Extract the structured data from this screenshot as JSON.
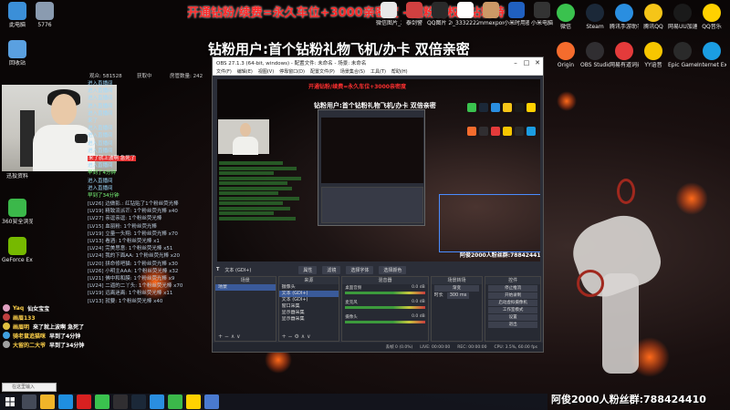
{
  "overlay": {
    "banner_top": "开通钻粉/续费=永久车位+3000亲密度 - 超粉特权+钻粉特",
    "banner_mid": "钻粉用户:首个钻粉礼物飞机/办卡 双倍亲密",
    "watermark": "阿俊2000人粉丝群:788424410",
    "stat_1": "观众: 581528",
    "stat_2": "获取中",
    "stat_3": "房管数量: 242"
  },
  "desktop_icons_left": [
    {
      "label": "此电脑",
      "icon": "computer-icon",
      "color": "#3b8fd8"
    },
    {
      "label": "5776",
      "icon": "file-icon",
      "color": "#8a9bb0"
    },
    {
      "label": "回收站",
      "icon": "recycle-bin-icon",
      "color": "#5aa0e0"
    },
    {
      "label": "迅投资料",
      "icon": "folder-icon",
      "color": "#2a5db0"
    },
    {
      "label": "360安全浏览器",
      "icon": "browser-icon",
      "color": "#3bb84a"
    },
    {
      "label": "GeForce Experience",
      "icon": "nvidia-icon",
      "color": "#76b900"
    }
  ],
  "desktop_icons_top": [
    {
      "label": "微信图片_2022062...",
      "icon": "image-icon",
      "color": "#e8e8e8"
    },
    {
      "label": "泰剑警",
      "icon": "game-icon",
      "color": "#d04040"
    },
    {
      "label": "QQ图片 20211223...",
      "icon": "image-icon",
      "color": "#2a2a2a"
    },
    {
      "label": "_3332222...",
      "icon": "file-icon",
      "color": "#ffffff"
    },
    {
      "label": "mmexport1...",
      "icon": "image-icon",
      "color": "#cc9966"
    },
    {
      "label": "小米时用器",
      "icon": "app-icon",
      "color": "#2060c0"
    },
    {
      "label": "小米电脑",
      "icon": "app-icon",
      "color": "#333333"
    }
  ],
  "desktop_icons_right": [
    {
      "label": "微信",
      "icon": "wechat-icon",
      "color": "#3ac24e"
    },
    {
      "label": "Steam",
      "icon": "steam-icon",
      "color": "#1b2838"
    },
    {
      "label": "腾讯手游助手",
      "icon": "tencent-icon",
      "color": "#2a8ee0"
    },
    {
      "label": "腾讯QQ",
      "icon": "qq-icon",
      "color": "#f5c518"
    },
    {
      "label": "网易UU加速器",
      "icon": "uu-icon",
      "color": "#1a1a1a"
    },
    {
      "label": "QQ音乐",
      "icon": "music-icon",
      "color": "#ffd100"
    },
    {
      "label": "Origin",
      "icon": "origin-icon",
      "color": "#f56c2d"
    },
    {
      "label": "OBS Studio",
      "icon": "obs-icon",
      "color": "#302e31"
    },
    {
      "label": "网易有道词典",
      "icon": "youdao-icon",
      "color": "#e43b3b"
    },
    {
      "label": "YY语音",
      "icon": "yy-icon",
      "color": "#f7c600"
    },
    {
      "label": "Epic Games Launcher",
      "icon": "epic-icon",
      "color": "#2a2a2a"
    },
    {
      "label": "Internet Explorer",
      "icon": "ie-icon",
      "color": "#1b9de2"
    }
  ],
  "chat_top": [
    {
      "text": "进入直播间",
      "style": "normal"
    },
    {
      "text": "进入直播间",
      "style": "normal"
    },
    {
      "text": "进入直播间",
      "style": "normal"
    },
    {
      "text": "进入直播间",
      "style": "normal"
    },
    {
      "text": "进入直播间",
      "style": "normal"
    },
    {
      "text": "来了",
      "style": "normal"
    },
    {
      "text": "进入直播间",
      "style": "normal"
    },
    {
      "text": "进入直播间",
      "style": "normal"
    },
    {
      "text": "进入直播间",
      "style": "normal"
    },
    {
      "text": "进入直播间",
      "style": "normal"
    },
    {
      "text": "来了就上波啊 急死了",
      "style": "highlight"
    },
    {
      "text": "进入直播间",
      "style": "normal"
    },
    {
      "text": "早到了4分钟",
      "style": "green"
    },
    {
      "text": "进入直播间",
      "style": "normal"
    },
    {
      "text": "进入直播间",
      "style": "normal"
    },
    {
      "text": "早到了34分钟",
      "style": "green"
    }
  ],
  "chat_gifts": [
    "[LV26] 边做影.: 红钻贴了1个粉丝荧光棒",
    "[LV19] 精致流派芒: 1个粉丝荧光棒 x40",
    "[LV27] 亲逗亲逗: 1个粉丝荧光棒",
    "[LV15] 血丽粉: 1个粉丝荧光棒",
    "[LV19] 立量一头翔: 1个粉丝荧光棒 x70",
    "[LV13] 看酒: 1个粉丝荧光棒 x1",
    "[LV24] 完美思意: 1个粉丝荧光棒 x51",
    "[LV24] 我的下面AA: 1个粉丝荧光棒 x20",
    "[LV20] 拼命修吧猫: 1个粉丝荧光棒 x30",
    "[LV26] 小明主AAA: 1个粉丝荧光棒 x32",
    "[LV21] 佛中和和膜: 1个粉丝荧光棒 x9",
    "[LV24] 二逼的二丫头: 1个粉丝荧光棒 x70",
    "[LV19] 远离迷离: 1个粉丝荧光棒 x11",
    "[LV13] 就要: 1个粉丝荧光棒 x40"
  ],
  "chat_bottom": [
    {
      "name": "Yaq",
      "msg": "仙女宝宝",
      "color": "#e0a0c0"
    },
    {
      "name": "画眉133",
      "msg": "",
      "color": "#c04040"
    },
    {
      "name": "画眉明",
      "msg": "来了就上波啊 急死了",
      "color": "#e0c040"
    },
    {
      "name": "骑老鼠追猫咪",
      "msg": "早到了4分钟",
      "color": "#40a0e0"
    },
    {
      "name": "大留的二大爷",
      "msg": "早到了34分钟",
      "color": "#a0a0a0"
    }
  ],
  "obs": {
    "title": "OBS 27.1.3 (64-bit, windows) - 配置文件: 未命名 - 场景: 未命名",
    "menu": [
      "文件(F)",
      "编辑(E)",
      "视图(V)",
      "停靠窗口(D)",
      "配置文件(P)",
      "场景集合(S)",
      "工具(T)",
      "帮助(H)"
    ],
    "preview_banner": "开通钻粉/续费=永久车位+3000亲密度",
    "preview_banner2": "钻粉用户:首个钻粉礼物飞机/办卡 双倍亲密",
    "preview_footer": "阿俊2000人粉丝群:788424410",
    "toolbar_label": "文本 (GDI+)",
    "toolbar_buttons": [
      "属性",
      "滤镜",
      "选择字体",
      "选择颜色"
    ],
    "docks": {
      "scenes_title": "场景",
      "scenes": [
        "场景"
      ],
      "sources_title": "来源",
      "sources": [
        "摄像头",
        "文本 (GDI+)",
        "文本 (GDI+)",
        "窗口采集",
        "显示器采集",
        "显示器采集"
      ],
      "mixer_title": "混音器",
      "mixer": [
        {
          "name": "桌面音频",
          "db": "0.0 dB"
        },
        {
          "name": "麦克风",
          "db": "0.0 dB"
        },
        {
          "name": "摄像头",
          "db": "0.0 dB"
        }
      ],
      "transitions_title": "场景转场",
      "transition_type": "渐变",
      "duration_label": "时长",
      "duration_value": "300 ms",
      "controls_title": "控件",
      "controls": [
        "停止推流",
        "开始录制",
        "启动虚拟摄像机",
        "工作室模式",
        "设置",
        "退出"
      ]
    },
    "status": [
      "丢帧 0 (0.0%)",
      "LIVE: 00:00:00",
      "REC: 00:00:00",
      "CPU: 3.5%, 60.00 fps"
    ]
  },
  "search": {
    "placeholder": "在这里输入"
  },
  "taskbar_apps": [
    {
      "icon": "task-view-icon",
      "color": "#444a58"
    },
    {
      "icon": "explorer-icon",
      "color": "#f0b429"
    },
    {
      "icon": "edge-icon",
      "color": "#1f8fe0"
    },
    {
      "icon": "app-red-icon",
      "color": "#d82020"
    },
    {
      "icon": "wechat-icon",
      "color": "#3ac24e"
    },
    {
      "icon": "obs-icon",
      "color": "#302e31"
    },
    {
      "icon": "steam-icon",
      "color": "#1b2838"
    },
    {
      "icon": "qq-icon",
      "color": "#2a8ee0"
    },
    {
      "icon": "browser-icon",
      "color": "#3bb84a"
    },
    {
      "icon": "music-icon",
      "color": "#ffd100"
    },
    {
      "icon": "folder-icon",
      "color": "#4a7ad0"
    }
  ]
}
